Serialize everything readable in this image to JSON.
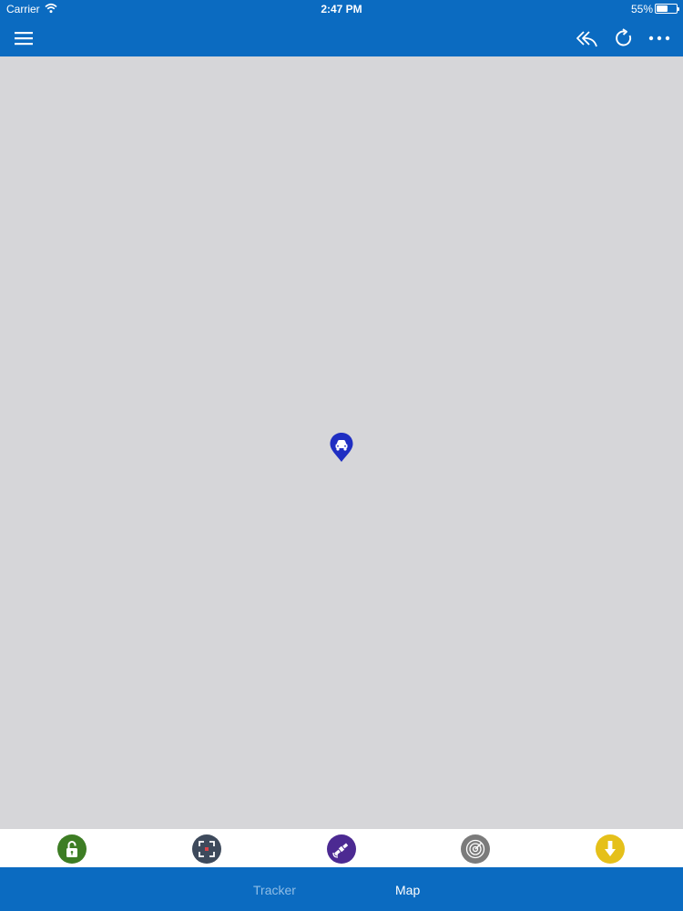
{
  "status_bar": {
    "carrier": "Carrier",
    "time": "2:47 PM",
    "battery": "55%",
    "battery_level": 0.55
  },
  "header": {
    "background_color": "#0b6bc1",
    "icons": [
      "menu-icon",
      "reply-icon",
      "refresh-icon",
      "more-icon"
    ]
  },
  "map": {
    "background_color": "#d6d6d9",
    "marker": {
      "icon": "car-icon",
      "color": "#1f2ec2"
    }
  },
  "action_bar": {
    "buttons": [
      {
        "icon": "unlock-icon",
        "color": "#3d7d24"
      },
      {
        "icon": "scan-icon",
        "color": "#3e4a5c"
      },
      {
        "icon": "satellite-icon",
        "color": "#4c2a92"
      },
      {
        "icon": "radar-icon",
        "color": "#7b7b7b"
      },
      {
        "icon": "download-icon",
        "color": "#e5c01a"
      }
    ]
  },
  "tabs": {
    "tracker": "Tracker",
    "map": "Map",
    "active": "map",
    "active_color": "#ffffff",
    "inactive_color": "#8fbde6"
  }
}
